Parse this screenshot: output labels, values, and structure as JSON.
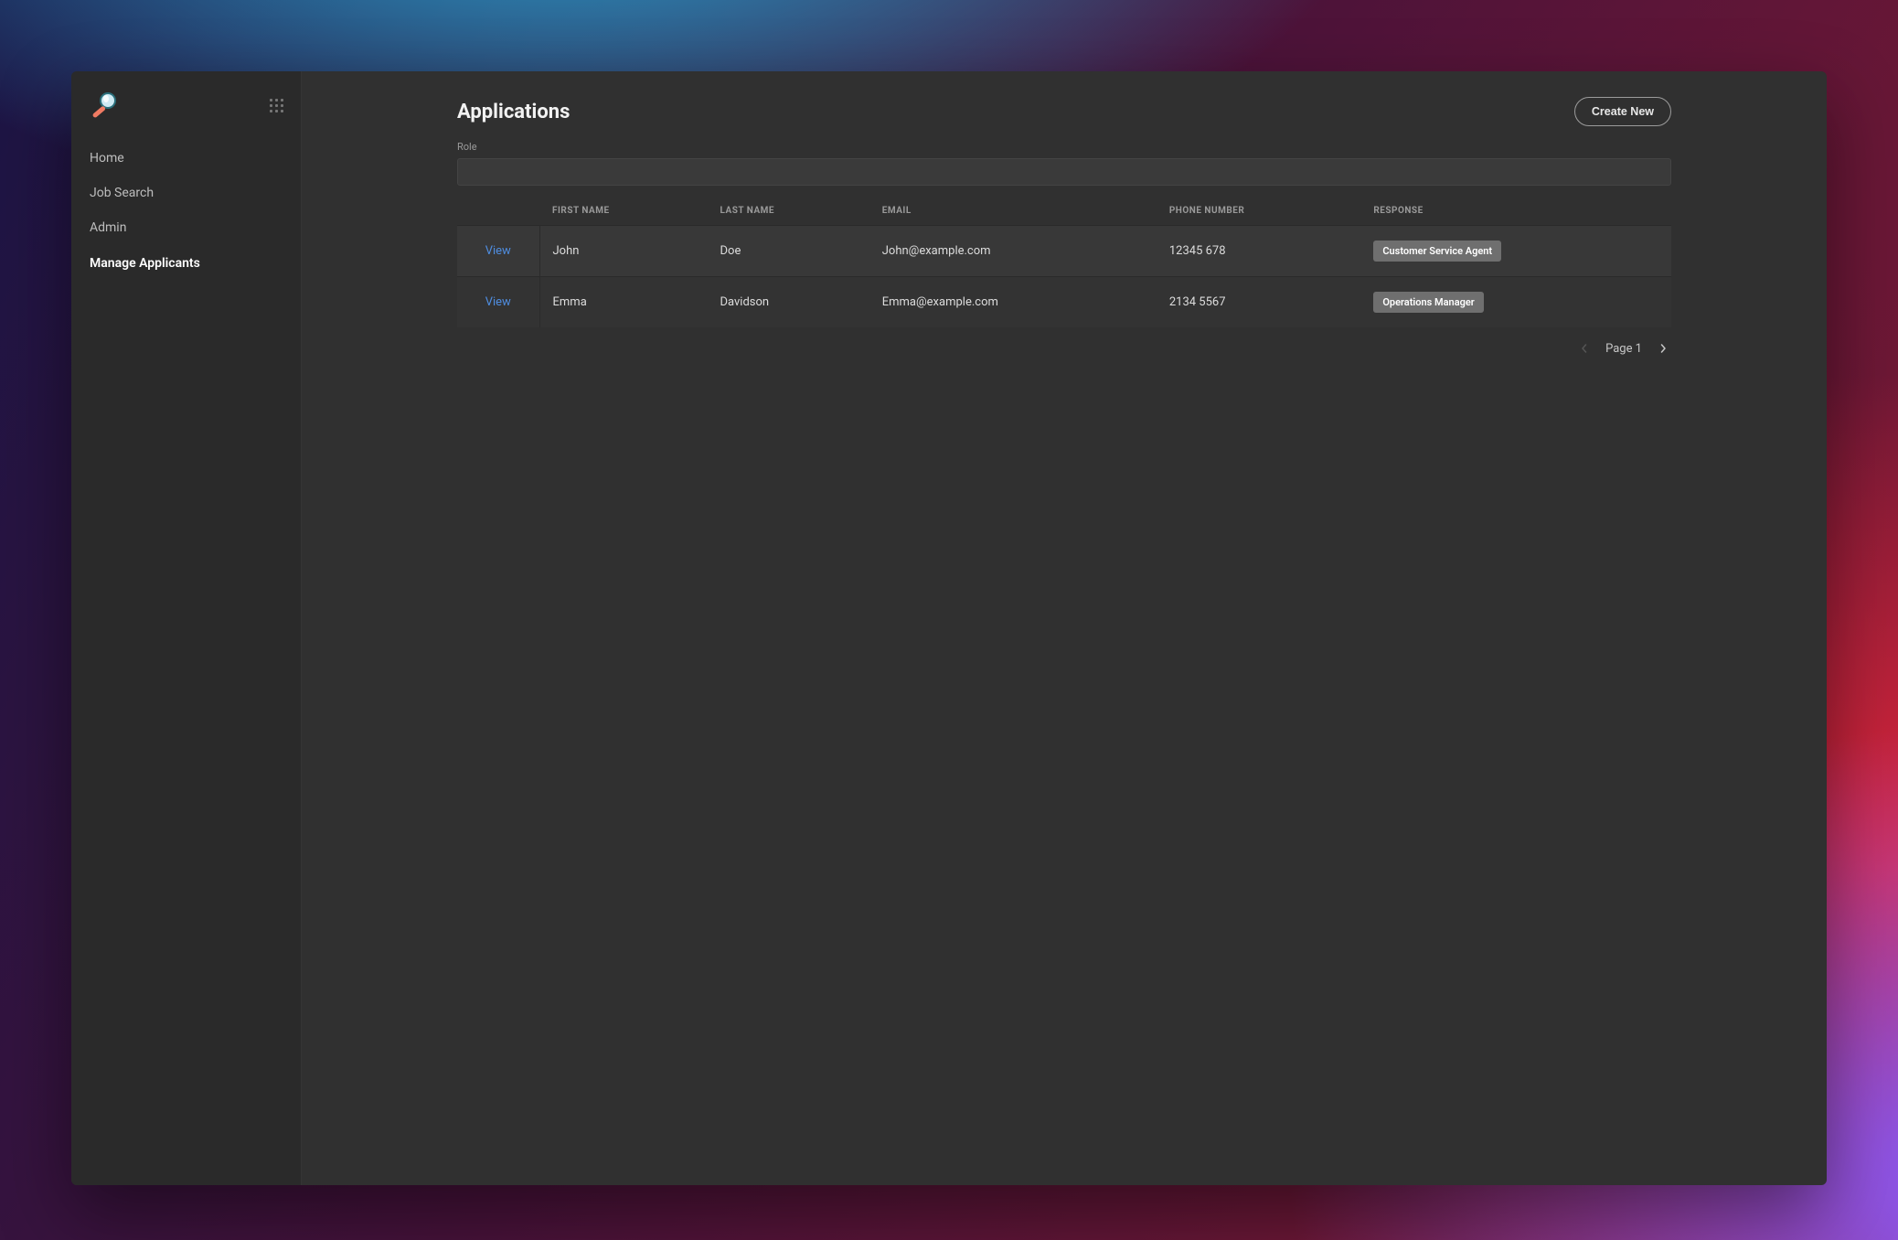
{
  "sidebar": {
    "items": [
      {
        "label": "Home",
        "active": false
      },
      {
        "label": "Job Search",
        "active": false
      },
      {
        "label": "Admin",
        "active": false
      },
      {
        "label": "Manage Applicants",
        "active": true
      }
    ]
  },
  "header": {
    "title": "Applications",
    "createNewLabel": "Create New"
  },
  "filter": {
    "roleLabel": "Role",
    "roleValue": ""
  },
  "table": {
    "columns": [
      "FIRST NAME",
      "LAST NAME",
      "EMAIL",
      "PHONE NUMBER",
      "RESPONSE"
    ],
    "viewLabel": "View",
    "rows": [
      {
        "firstName": "John",
        "lastName": "Doe",
        "email": "John@example.com",
        "phone": "12345 678",
        "response": "Customer Service Agent"
      },
      {
        "firstName": "Emma",
        "lastName": "Davidson",
        "email": "Emma@example.com",
        "phone": "2134 5567",
        "response": "Operations Manager"
      }
    ]
  },
  "pagination": {
    "pageLabel": "Page 1",
    "prevEnabled": false,
    "nextEnabled": true
  }
}
